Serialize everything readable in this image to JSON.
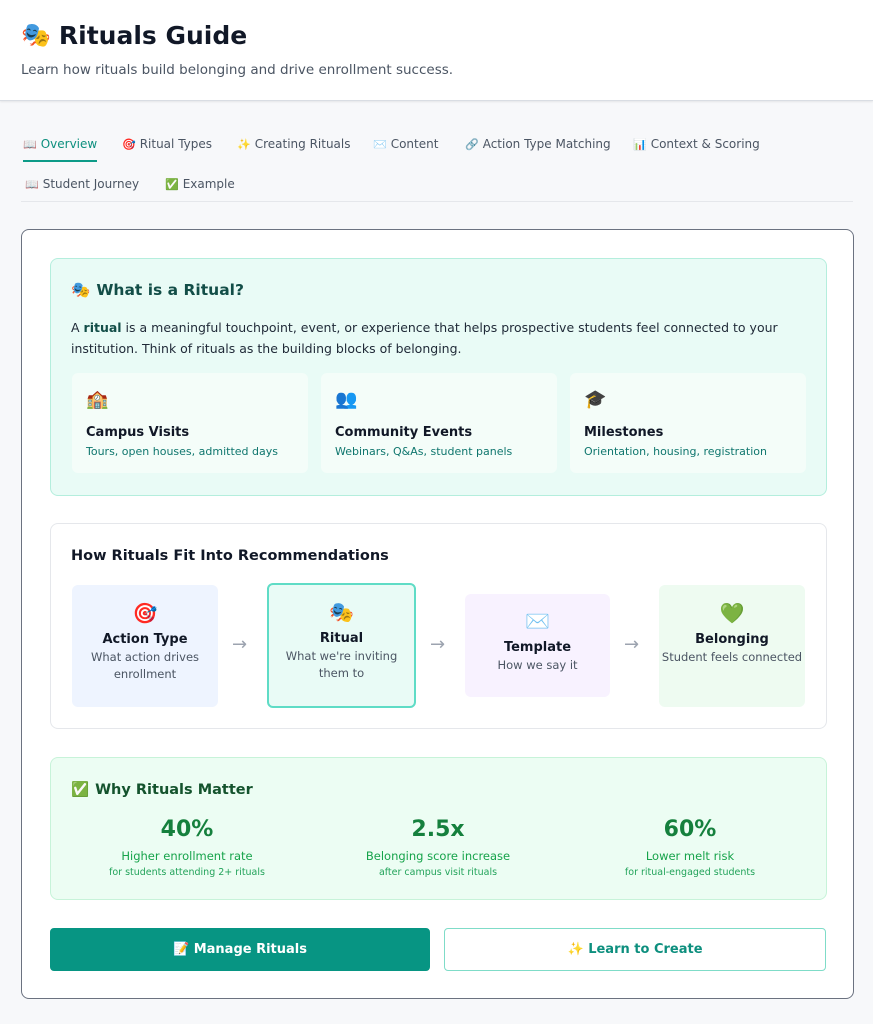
{
  "header": {
    "title_icon": "🎭",
    "title": "Rituals Guide",
    "subtitle": "Learn how rituals build belonging and drive enrollment success."
  },
  "tabs": [
    {
      "icon": "📖",
      "label": "Overview",
      "active": true
    },
    {
      "icon": "🎯",
      "label": "Ritual Types"
    },
    {
      "icon": "✨",
      "label": "Creating Rituals"
    },
    {
      "icon": "✉️",
      "label": "Content"
    },
    {
      "icon": "🔗",
      "label": "Action Type Matching"
    },
    {
      "icon": "📊",
      "label": "Context & Scoring"
    },
    {
      "icon": "📖",
      "label": "Student Journey"
    },
    {
      "icon": "✅",
      "label": "Example"
    }
  ],
  "what": {
    "icon": "🎭",
    "heading": "What is a Ritual?",
    "desc_prefix": "A ",
    "desc_bold": "ritual",
    "desc_rest": " is a meaningful touchpoint, event, or experience that helps prospective students feel connected to your institution. Think of rituals as the building blocks of belonging.",
    "cards": [
      {
        "icon": "🏫",
        "title": "Campus Visits",
        "desc": "Tours, open houses, admitted days"
      },
      {
        "icon": "👥",
        "title": "Community Events",
        "desc": "Webinars, Q&As, student panels"
      },
      {
        "icon": "🎓",
        "title": "Milestones",
        "desc": "Orientation, housing, registration"
      }
    ]
  },
  "fit": {
    "heading": "How Rituals Fit Into Recommendations",
    "arrow": "→",
    "steps": [
      {
        "icon": "🎯",
        "title": "Action Type",
        "desc": "What action drives enrollment"
      },
      {
        "icon": "🎭",
        "title": "Ritual",
        "desc": "What we're inviting them to"
      },
      {
        "icon": "✉️",
        "title": "Template",
        "desc": "How we say it"
      },
      {
        "icon": "💚",
        "title": "Belonging",
        "desc": "Student feels connected"
      }
    ]
  },
  "why": {
    "icon": "✅",
    "heading": "Why Rituals Matter",
    "stats": [
      {
        "value": "40%",
        "label": "Higher enrollment rate",
        "sub": "for students attending 2+ rituals"
      },
      {
        "value": "2.5x",
        "label": "Belonging score increase",
        "sub": "after campus visit rituals"
      },
      {
        "value": "60%",
        "label": "Lower melt risk",
        "sub": "for ritual-engaged students"
      }
    ]
  },
  "actions": {
    "manage_icon": "📝",
    "manage_label": "Manage Rituals",
    "learn_icon": "✨",
    "learn_label": "Learn to Create"
  },
  "colors": {
    "accent": "#079583",
    "ritual_bg": "#e9fbf6",
    "why_bg": "#ecfdf3",
    "stat_green": "#15803d"
  }
}
